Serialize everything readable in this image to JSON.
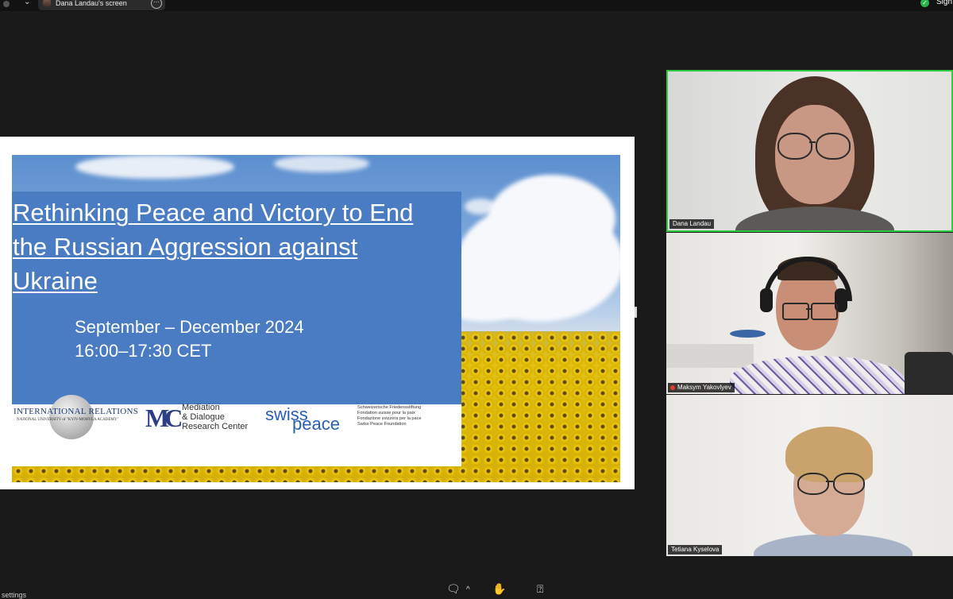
{
  "top_bar": {
    "screen_share_label": "Dana Landau's screen",
    "more_icon": "more-icon",
    "sign_label": "Sign",
    "shield_color": "#2bb34a"
  },
  "slide": {
    "title": "Rethinking Peace and Victory to End the Russian Aggression against Ukraine",
    "dates_line1": "September – December 2024",
    "dates_line2": "16:00–17:30 CET",
    "panel_color": "#4a7cc3",
    "logos": {
      "ir_name": "INTERNATIONAL RELATIONS",
      "ir_subtitle": "NATIONAL UNIVERSITY of \"KYIV-MOHYLA ACADEMY\"",
      "mdrc_line1": "Mediation",
      "mdrc_line2": "& Dialogue",
      "mdrc_line3": "Research Center",
      "swisspeace_word1": "swiss",
      "swisspeace_word2": "peace",
      "swisspeace_desc1": "Schweizerische Friedensstiftung",
      "swisspeace_desc2": "Fondation suisse pour la paix",
      "swisspeace_desc3": "Fondazione svizzera per la pace",
      "swisspeace_desc4": "Swiss Peace Foundation"
    }
  },
  "participants": [
    {
      "name": "Dana Landau",
      "active_speaker": true,
      "highlight_color": "#2ecc40"
    },
    {
      "name": "Maksym Yakovlyev",
      "muted": true
    },
    {
      "name": "Tetiana Kyselova"
    }
  ],
  "bottom_bar": {
    "settings_label": "settings",
    "icons": [
      "chat-icon",
      "chevron-up-icon",
      "raise-hand-icon",
      "question-icon"
    ]
  }
}
